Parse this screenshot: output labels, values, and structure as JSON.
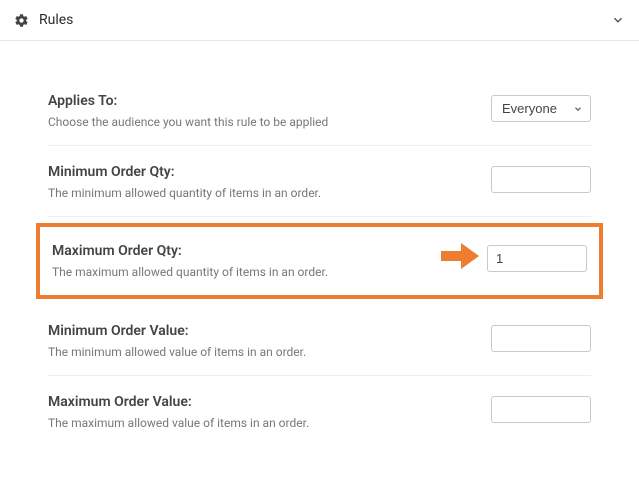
{
  "accent_color": "#ed7d31",
  "header": {
    "title": "Rules"
  },
  "rows": {
    "appliesTo": {
      "label": "Applies To:",
      "help": "Choose the audience you want this rule to be applied",
      "selected": "Everyone"
    },
    "minQty": {
      "label": "Minimum Order Qty:",
      "help": "The minimum allowed quantity of items in an order.",
      "value": ""
    },
    "maxQty": {
      "label": "Maximum Order Qty:",
      "help": "The maximum allowed quantity of items in an order.",
      "value": "1"
    },
    "minValue": {
      "label": "Minimum Order Value:",
      "help": "The minimum allowed value of items in an order.",
      "value": ""
    },
    "maxValue": {
      "label": "Maximum Order Value:",
      "help": "The maximum allowed value of items in an order.",
      "value": ""
    }
  }
}
